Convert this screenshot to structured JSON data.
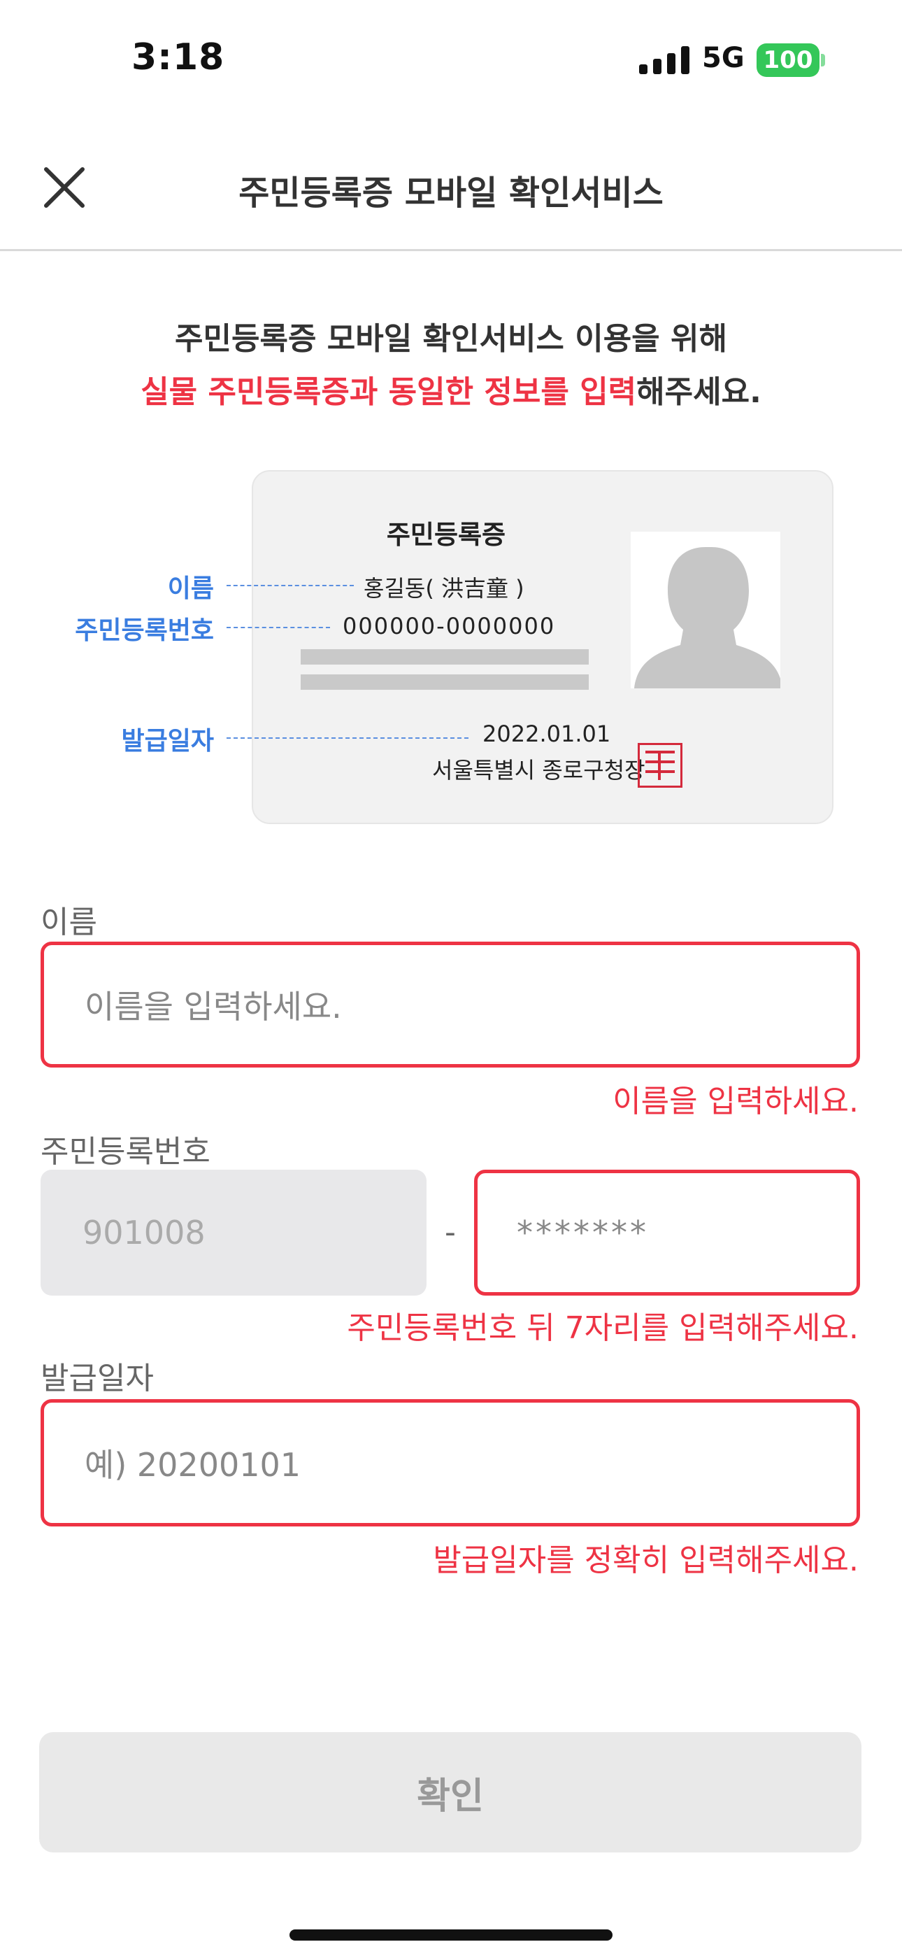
{
  "status_bar": {
    "time": "3:18",
    "network": "5G",
    "battery": "100"
  },
  "header": {
    "title": "주민등록증 모바일 확인서비스",
    "close_icon": "close-icon"
  },
  "intro": {
    "line1": "주민등록증 모바일 확인서비스 이용을 위해",
    "line2_highlight": "실물 주민등록증과 동일한 정보를 입력",
    "line2_rest": "해주세요."
  },
  "card": {
    "title": "주민등록증",
    "name_value": "홍길동( 洪吉童 )",
    "rrn_value": "000000-0000000",
    "issue_date_value": "2022.01.01",
    "issuer": "서울특별시 종로구청장",
    "annotations": {
      "name": "이름",
      "rrn": "주민등록번호",
      "issue_date": "발급일자"
    }
  },
  "form": {
    "name": {
      "label": "이름",
      "placeholder": "이름을 입력하세요.",
      "error": "이름을 입력하세요."
    },
    "rrn": {
      "label": "주민등록번호",
      "front_value": "901008",
      "separator": "-",
      "back_value": "*******",
      "error": "주민등록번호 뒤 7자리를 입력해주세요."
    },
    "issue_date": {
      "label": "발급일자",
      "placeholder": "예) 20200101",
      "error": "발급일자를 정확히 입력해주세요."
    }
  },
  "confirm_label": "확인",
  "colors": {
    "error": "#ee3344",
    "annotation": "#3a7de0",
    "battery": "#34c759"
  }
}
